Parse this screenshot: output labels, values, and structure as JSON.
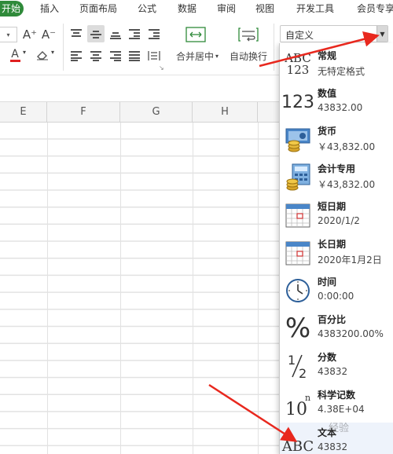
{
  "menu": {
    "tabs": [
      {
        "label": "开始",
        "active": true
      },
      {
        "label": "插入"
      },
      {
        "label": "页面布局"
      },
      {
        "label": "公式"
      },
      {
        "label": "数据"
      },
      {
        "label": "审阅"
      },
      {
        "label": "视图"
      },
      {
        "label": "开发工具"
      },
      {
        "label": "会员专享"
      }
    ]
  },
  "ribbon": {
    "font_increase": "A⁺",
    "font_decrease": "A⁻",
    "font_color": "A",
    "merge_center_label": "合并居中",
    "wrap_text_label": "自动换行",
    "number_format_value": "自定义"
  },
  "columns": [
    "E",
    "F",
    "G",
    "H"
  ],
  "format_menu": {
    "items": [
      {
        "name": "常规",
        "sample": "无特定格式",
        "icon": "abc-123-icon"
      },
      {
        "name": "数值",
        "sample": "43832.00",
        "icon": "number-123-icon"
      },
      {
        "name": "货币",
        "sample": "￥43,832.00",
        "icon": "currency-icon"
      },
      {
        "name": "会计专用",
        "sample": "￥43,832.00",
        "icon": "accounting-icon"
      },
      {
        "name": "短日期",
        "sample": "2020/1/2",
        "icon": "short-date-calendar-icon"
      },
      {
        "name": "长日期",
        "sample": "2020年1月2日",
        "icon": "long-date-calendar-icon"
      },
      {
        "name": "时间",
        "sample": "0:00:00",
        "icon": "clock-icon"
      },
      {
        "name": "百分比",
        "sample": "4383200.00%",
        "icon": "percent-icon"
      },
      {
        "name": "分数",
        "sample": "43832",
        "icon": "fraction-icon"
      },
      {
        "name": "科学记数",
        "sample": "4.38E+04",
        "icon": "scientific-icon"
      },
      {
        "name": "文本",
        "sample": "43832",
        "icon": "text-abc-icon"
      }
    ]
  },
  "watermark": "经验"
}
